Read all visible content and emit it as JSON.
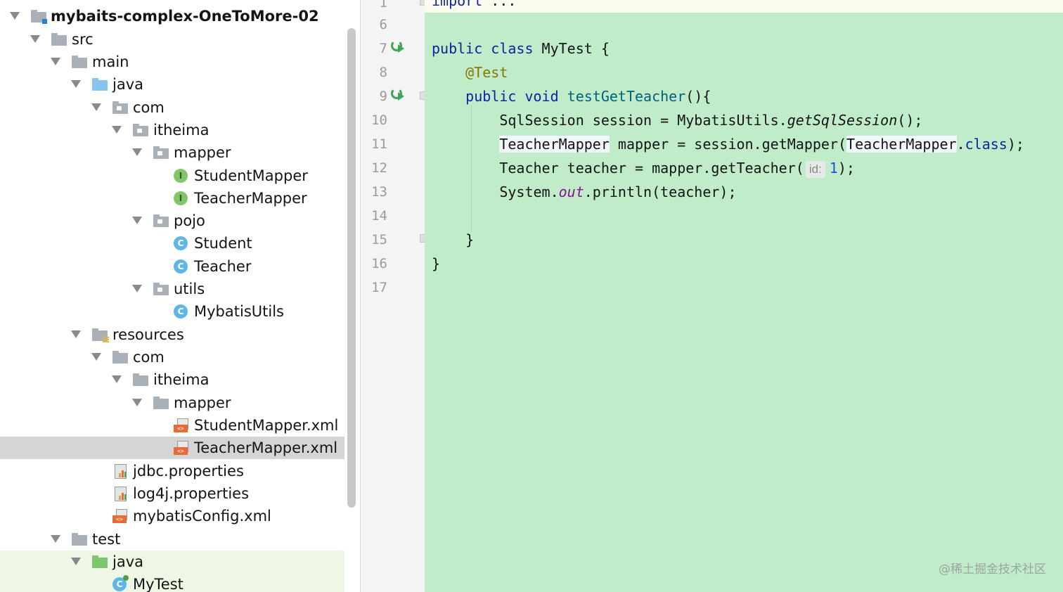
{
  "project_tree": {
    "root": "mybaits-complex-OneToMore-02",
    "src": "src",
    "main": "main",
    "java": "java",
    "com": "com",
    "itheima": "itheima",
    "mapper": "mapper",
    "student_mapper": "StudentMapper",
    "teacher_mapper": "TeacherMapper",
    "pojo": "pojo",
    "student": "Student",
    "teacher": "Teacher",
    "utils": "utils",
    "mybatis_utils": "MybatisUtils",
    "resources": "resources",
    "res_com": "com",
    "res_itheima": "itheima",
    "res_mapper": "mapper",
    "student_mapper_xml": "StudentMapper.xml",
    "teacher_mapper_xml": "TeacherMapper.xml",
    "jdbc_properties": "jdbc.properties",
    "log4j_properties": "log4j.properties",
    "mybatis_config": "mybatisConfig.xml",
    "test": "test",
    "test_java": "java",
    "my_test": "MyTest",
    "interface_badge": "I",
    "class_badge": "C",
    "xml_tag": "<>"
  },
  "editor": {
    "line_numbers": [
      "1",
      "6",
      "7",
      "8",
      "9",
      "10",
      "11",
      "12",
      "13",
      "14",
      "15",
      "16",
      "17"
    ],
    "import_keyword": "import",
    "import_folded": " ...",
    "line7": {
      "kw": "public class",
      "rest": " MyTest {"
    },
    "line8": {
      "annotation": "@Test"
    },
    "line9": {
      "kw": "public void",
      "fn": "testGetTeacher",
      "rest": "(){"
    },
    "line10": {
      "pre": "SqlSession session = MybatisUtils.",
      "call": "getSqlSession",
      "post": "();"
    },
    "line11": {
      "t1": "TeacherMapper",
      "mid": " mapper = session.getMapper(",
      "t2": "TeacherMapper",
      "dot": ".",
      "kw": "class",
      "post": ");"
    },
    "line12": {
      "pre": "Teacher teacher = mapper.getTeacher(",
      "hint": "id:",
      "num": "1",
      "post": ");"
    },
    "line13": {
      "pre": "System.",
      "field": "out",
      "post": ".println(teacher);"
    },
    "line15": "}",
    "line16": "}"
  },
  "watermark": "@稀土掘金技术社区",
  "colors": {
    "editor_bg": "#c0ecc9",
    "keyword": "#10239e",
    "annotation": "#8a7600",
    "method": "#00627a",
    "field": "#871094",
    "number": "#1750eb",
    "selected_row": "#d5d5d5"
  }
}
